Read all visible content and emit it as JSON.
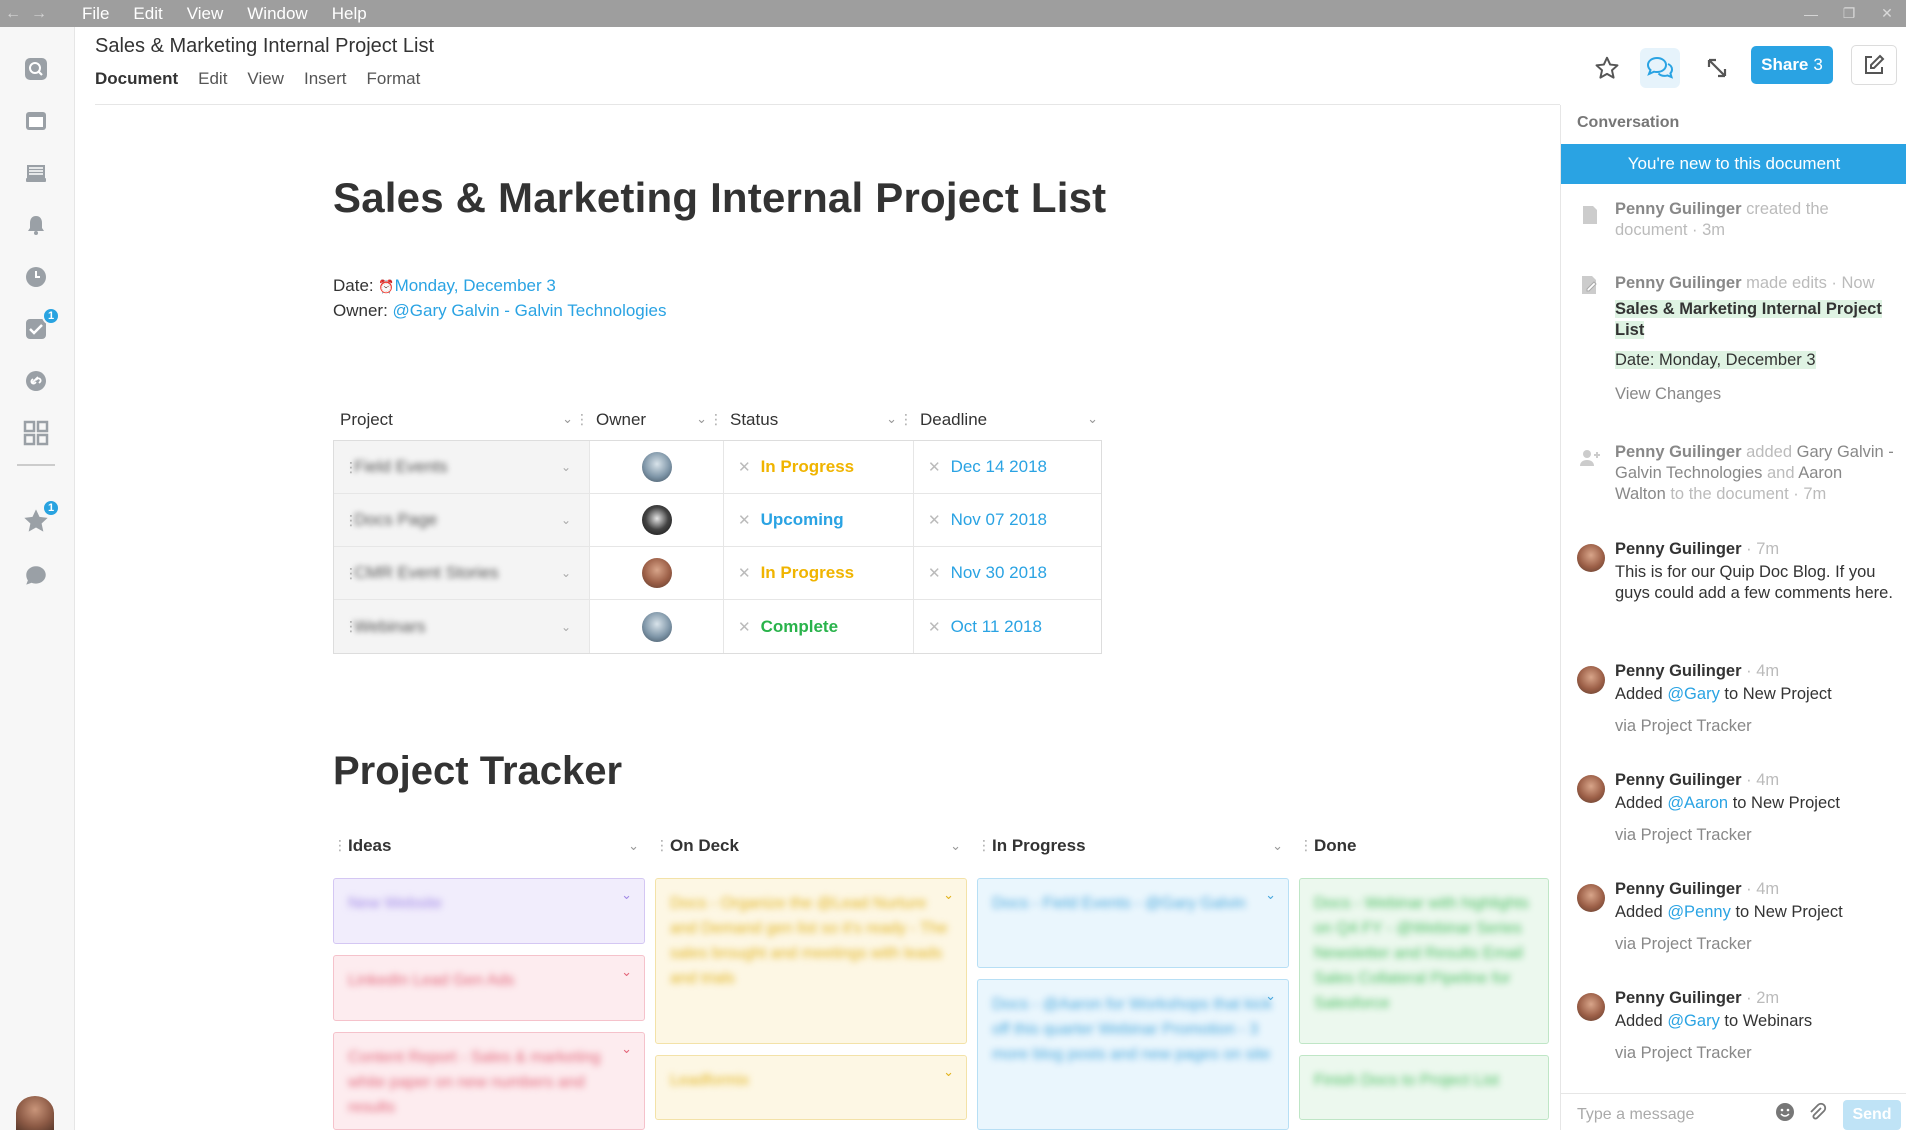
{
  "menubar": {
    "items": [
      "File",
      "Edit",
      "View",
      "Window",
      "Help"
    ]
  },
  "sidebar": {
    "icons": [
      "search-icon",
      "browser-icon",
      "inbox-icon",
      "bell-icon",
      "clock-icon",
      "tasks-icon",
      "link-icon",
      "apps-grid-icon",
      "star-icon",
      "chat-icon"
    ],
    "tasks_badge": "1",
    "favorites_badge": "1"
  },
  "header": {
    "title": "Sales & Marketing Internal Project List",
    "tabs": [
      "Document",
      "Edit",
      "View",
      "Insert",
      "Format"
    ],
    "share_label": "Share",
    "share_count": "3"
  },
  "doc": {
    "title": "Sales & Marketing Internal Project List",
    "date_label": "Date:",
    "date_value": "Monday, December 3",
    "owner_label": "Owner:",
    "owner_value": "@Gary Galvin - Galvin Technologies"
  },
  "table": {
    "columns": [
      "Project",
      "Owner",
      "Status",
      "Deadline"
    ],
    "rows": [
      {
        "project": "Field Events",
        "owner": "Gary Galvin",
        "status": "In Progress",
        "deadline": "Dec 14 2018"
      },
      {
        "project": "Docs Page",
        "owner": "Aaron Walton",
        "status": "Upcoming",
        "deadline": "Nov 07 2018"
      },
      {
        "project": "CMR Event Stories",
        "owner": "Penny Guilinger",
        "status": "In Progress",
        "deadline": "Nov 30 2018"
      },
      {
        "project": "Webinars",
        "owner": "Gary Galvin",
        "status": "Complete",
        "deadline": "Oct 11 2018"
      }
    ]
  },
  "tracker": {
    "title": "Project Tracker",
    "columns": [
      "Ideas",
      "On Deck",
      "In Progress",
      "Done"
    ],
    "cards": {
      "ideas": [
        "New Website",
        "LinkedIn Lead Gen Ads",
        "Content Report - Sales & marketing white paper on new numbers and results"
      ],
      "on_deck": [
        "Docs - Organize the @Lead Nurture and Demand gen list so it's ready - The sales brought and meetings with leads and trials",
        "Leadformix"
      ],
      "in_progress": [
        "Docs - Field Events - @Gary Galvin",
        "Docs - @Aaron for Workshops that kick off this quarter Webinar Promotion - 3 more blog posts and new pages on site"
      ],
      "done": [
        "Docs - Webinar with highlights on Q4 FY - @Webinar Series Newsletter and Results Email Sales Collateral Pipeline for Salesforce",
        "Finish Docs to Project List"
      ]
    }
  },
  "conversation": {
    "title": "Conversation",
    "banner": "You're new to this document",
    "events": [
      {
        "name": "Penny Guilinger",
        "text": "created the document · 3m"
      },
      {
        "name": "Penny Guilinger",
        "meta": "made edits · Now",
        "edit1": "Sales & Marketing Internal Project List",
        "edit2": "Date: Monday, December 3",
        "view_changes": "View Changes"
      },
      {
        "name": "Penny Guilinger",
        "t1": "added",
        "who1": "Gary Galvin - Galvin Technologies",
        "t2": "and",
        "who2": "Aaron Walton",
        "t3": "to the document · 7m"
      }
    ],
    "messages": [
      {
        "name": "Penny Guilinger",
        "time": "· 7m",
        "body": "This is for our Quip Doc Blog. If you guys could add a few comments here."
      },
      {
        "name": "Penny Guilinger",
        "time": "· 4m",
        "pre": "Added",
        "mention": "@Gary",
        "post": "to New Project",
        "via": "via Project Tracker"
      },
      {
        "name": "Penny Guilinger",
        "time": "· 4m",
        "pre": "Added",
        "mention": "@Aaron",
        "post": "to New Project",
        "via": "via Project Tracker"
      },
      {
        "name": "Penny Guilinger",
        "time": "· 4m",
        "pre": "Added",
        "mention": "@Penny",
        "post": "to New Project",
        "via": "via Project Tracker"
      },
      {
        "name": "Penny Guilinger",
        "time": "· 2m",
        "pre": "Added",
        "mention": "@Gary",
        "post": "to Webinars",
        "via": "via Project Tracker"
      }
    ],
    "input_placeholder": "Type a message",
    "send_label": "Send"
  },
  "colors": {
    "accent": "#2aa3e3",
    "in_progress": "#f0b400",
    "complete": "#29b34b"
  }
}
